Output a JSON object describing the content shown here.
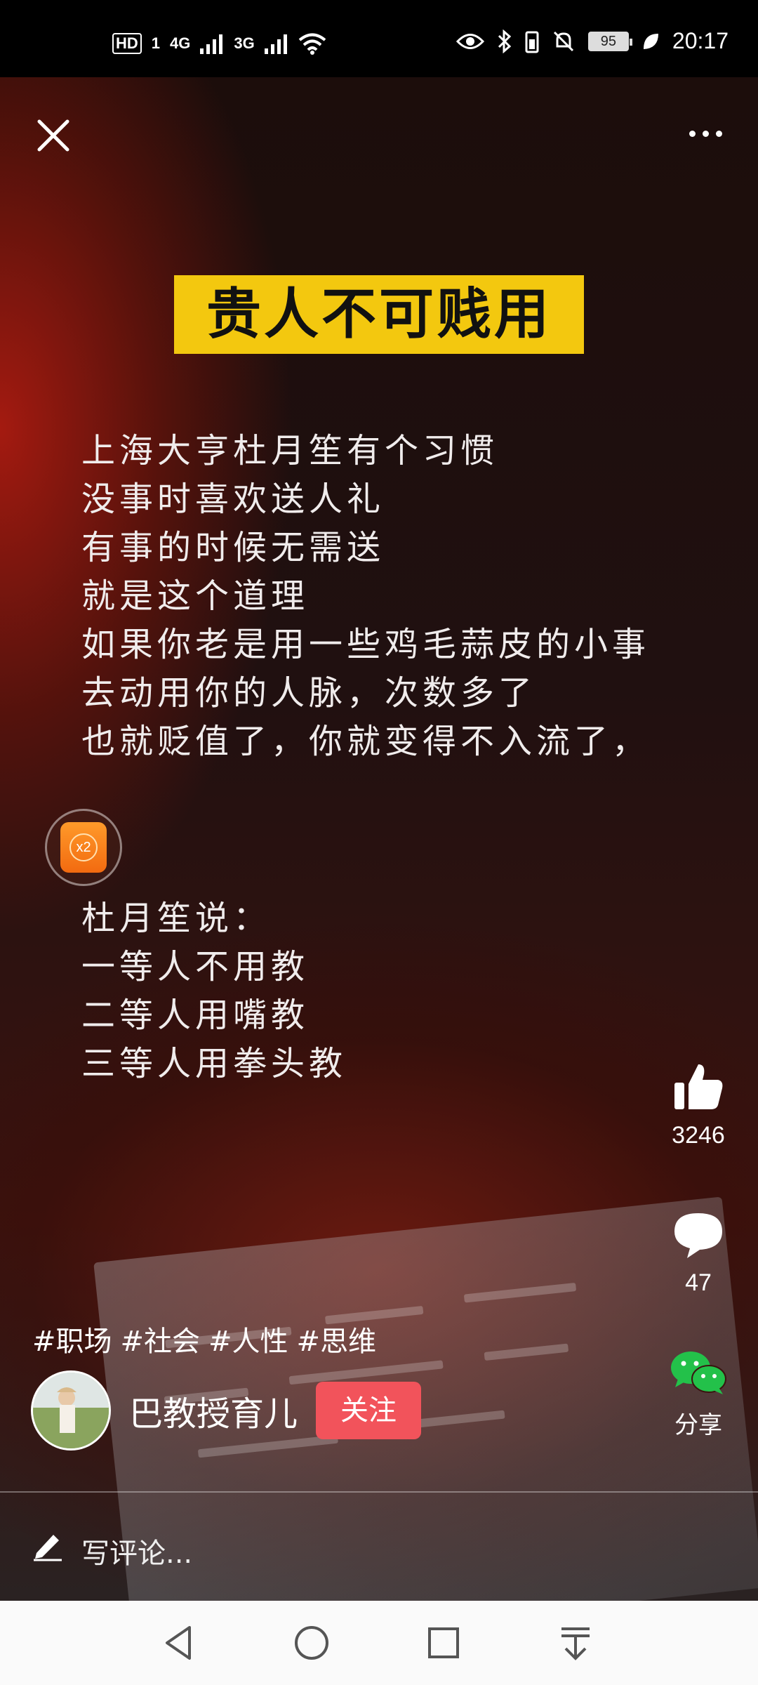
{
  "status_bar": {
    "hd_label": "HD",
    "sim_label": "1",
    "net1": "4G",
    "net2": "3G",
    "battery": "95",
    "time": "20:17"
  },
  "video": {
    "headline": "贵人不可贱用",
    "paragraph1": [
      "上海大亨杜月笙有个习惯",
      "没事时喜欢送人礼",
      "有事的时候无需送",
      "就是这个道理",
      "如果你老是用一些鸡毛蒜皮的小事",
      "去动用你的人脉，次数多了",
      "也就贬值了，你就变得不入流了，"
    ],
    "paragraph2": [
      "杜月笙说：",
      "一等人不用教",
      "二等人用嘴教",
      "三等人用拳头教"
    ],
    "badge_label": "x2"
  },
  "actions": {
    "likes": "3246",
    "comments": "47",
    "share_label": "分享"
  },
  "tags": [
    "#职场",
    "#社会",
    "#人性",
    "#思维"
  ],
  "author": {
    "name": "巴教授育儿",
    "follow_label": "关注"
  },
  "comment": {
    "placeholder": "写评论..."
  },
  "colors": {
    "headline_bg": "#f3c80f",
    "follow_bg": "#f2535b",
    "wechat_green": "#23c14a"
  }
}
